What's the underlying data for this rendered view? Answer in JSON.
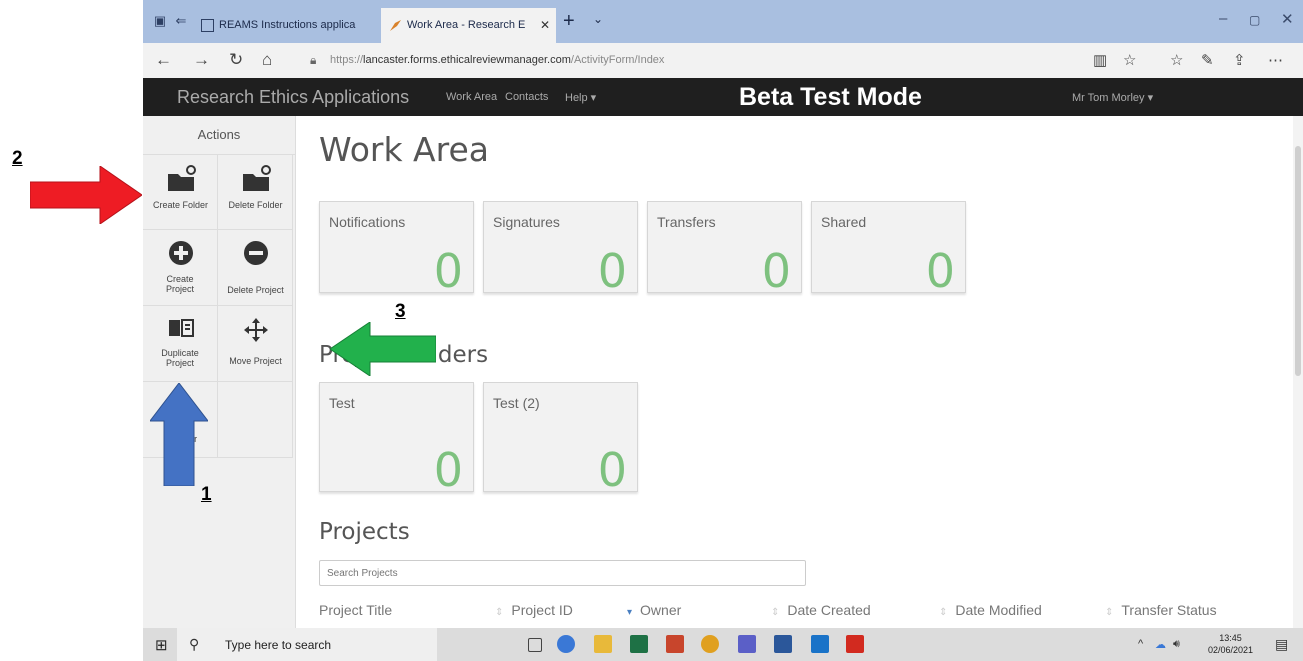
{
  "annotations": [
    {
      "number": "2",
      "color": "#ee1c24",
      "direction": "right"
    },
    {
      "number": "3",
      "color": "#22b14c",
      "direction": "left"
    },
    {
      "number": "1",
      "color": "#4472c4",
      "direction": "up"
    }
  ],
  "browser": {
    "tabs": [
      {
        "label": "REAMS Instructions applica",
        "active": false
      },
      {
        "label": "Work Area - Research E",
        "active": true
      }
    ],
    "url_prefix": "https://",
    "url_host": "lancaster.forms.ethicalreviewmanager.com",
    "url_path": "/ActivityForm/Index"
  },
  "app_nav": {
    "brand": "Research Ethics Applications",
    "links": [
      "Work Area",
      "Contacts",
      "Help ▾"
    ],
    "mode_banner": "Beta Test Mode",
    "user": "Mr Tom Morley ▾"
  },
  "sidebar": {
    "heading": "Actions",
    "actions": [
      {
        "label": "Create Folder",
        "icon": "folder-plus-icon"
      },
      {
        "label": "Delete Folder",
        "icon": "folder-minus-icon"
      },
      {
        "label": "Create Project",
        "icon": "plus-circle-icon"
      },
      {
        "label": "Delete Project",
        "icon": "minus-circle-icon"
      },
      {
        "label": "Duplicate Project",
        "icon": "duplicate-icon"
      },
      {
        "label": "Move Project",
        "icon": "move-icon"
      },
      {
        "label": "Transfer",
        "icon": "transfer-icon"
      }
    ]
  },
  "main": {
    "title": "Work Area",
    "summary_tiles": [
      {
        "label": "Notifications",
        "count": "0"
      },
      {
        "label": "Signatures",
        "count": "0"
      },
      {
        "label": "Transfers",
        "count": "0"
      },
      {
        "label": "Shared",
        "count": "0"
      }
    ],
    "folders_heading": "Project Folders",
    "folders": [
      {
        "label": "Test",
        "count": "0"
      },
      {
        "label": "Test (2)",
        "count": "0"
      }
    ],
    "projects_heading": "Projects",
    "search_placeholder": "Search Projects",
    "columns": [
      "Project Title",
      "Project ID",
      "Owner",
      "Date Created",
      "Date Modified",
      "Transfer Status"
    ]
  },
  "taskbar": {
    "search_placeholder": "Type here to search",
    "time": "13:45",
    "date": "02/06/2021"
  },
  "colors": {
    "count_green": "#7ec17f",
    "nav_bg": "#1f1f1f",
    "tabstrip": "#a9bfe0"
  }
}
